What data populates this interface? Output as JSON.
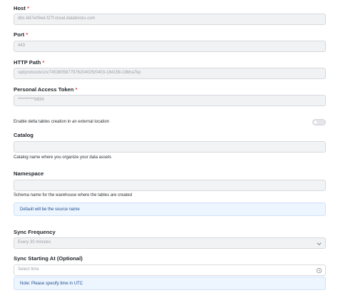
{
  "host": {
    "label": "Host",
    "required": "*",
    "value": "dbc-b87e09ed-f27f.cloud.databricks.com"
  },
  "port": {
    "label": "Port",
    "required": "*",
    "value": "443"
  },
  "http_path": {
    "label": "HTTP Path",
    "required": "*",
    "value": "sql/protocolv1/o/7453805877976204025/0403-184158-19bha7kp"
  },
  "token": {
    "label": "Personal Access Token",
    "required": "*",
    "value": "**********b834"
  },
  "external_location": {
    "label": "Enable delta tables creation in an external location",
    "enabled": false
  },
  "catalog": {
    "label": "Catalog",
    "value": "",
    "help": "Catalog name where you organize your data assets"
  },
  "namespace": {
    "label": "Namespace",
    "value": "",
    "help": "Schema name for the warehouse where the tables are created",
    "note": "Default will be the source name"
  },
  "sync_frequency": {
    "label": "Sync Frequency",
    "value": "Every 30 minutes",
    "icon": "chevron-down-icon"
  },
  "sync_starting_at": {
    "label": "Sync Starting At (Optional)",
    "placeholder": "Select time",
    "icon": "clock-icon",
    "note": "Note: Please specify time in UTC"
  },
  "colors": {
    "accent_note_bg": "#edf5ff",
    "required": "#e5484d"
  }
}
